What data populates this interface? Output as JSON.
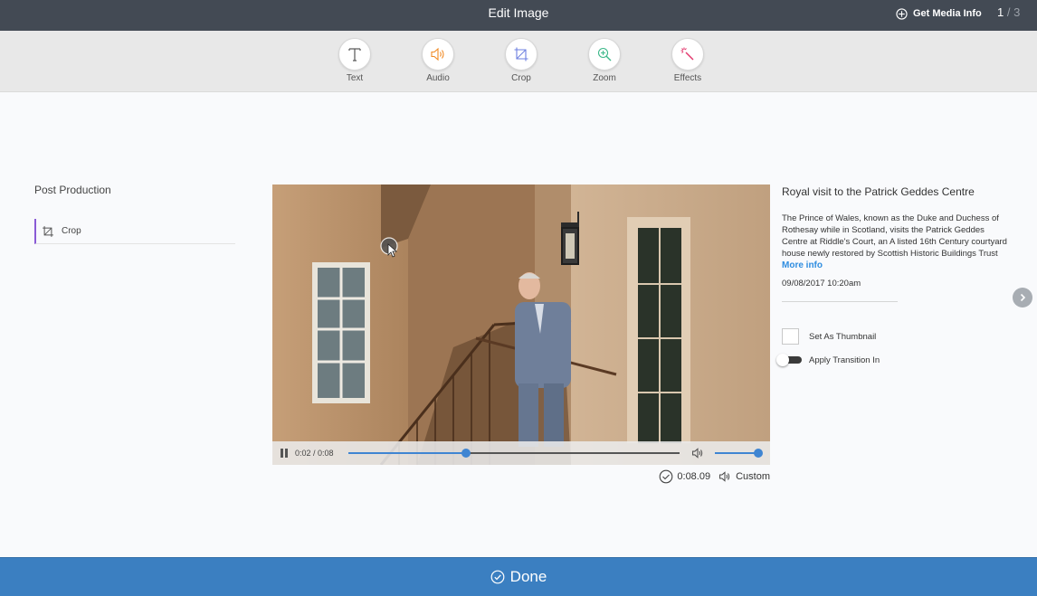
{
  "header": {
    "title": "Edit Image",
    "media_info_label": "Get Media Info",
    "page_current": "1",
    "page_separator": "/",
    "page_total": "3"
  },
  "toolbar": {
    "tools": [
      {
        "label": "Text",
        "icon": "text-icon",
        "color": "#555555"
      },
      {
        "label": "Audio",
        "icon": "audio-icon",
        "color": "#f08a24"
      },
      {
        "label": "Crop",
        "icon": "crop-icon",
        "color": "#6d7fe0"
      },
      {
        "label": "Zoom",
        "icon": "zoom-icon",
        "color": "#3cb88a"
      },
      {
        "label": "Effects",
        "icon": "magic-wand-icon",
        "color": "#e2356b"
      }
    ]
  },
  "post_production": {
    "title": "Post Production",
    "items": [
      {
        "label": "Crop",
        "icon": "crop-icon",
        "accent": "#8a5bd6"
      }
    ]
  },
  "player": {
    "time": "0:02 / 0:08",
    "progress": 0.355,
    "volume": 1.0,
    "duration": "0:08.09",
    "audio_mode": "Custom",
    "accent": "#3f85d2"
  },
  "media": {
    "title": "Royal visit to the Patrick Geddes Centre",
    "description": "The Prince of Wales, known as the Duke and Duchess of Rothesay while in Scotland, visits the Patrick Geddes Centre at Riddle's Court, an A listed 16th Century courtyard house newly restored by Scottish Historic Buildings Trust",
    "more_info": "More info",
    "date": "09/08/2017 10:20am",
    "thumbnail_label": "Set As Thumbnail",
    "transition_label": "Apply Transition In"
  },
  "footer": {
    "done_label": "Done",
    "color": "#3b7fc1"
  }
}
